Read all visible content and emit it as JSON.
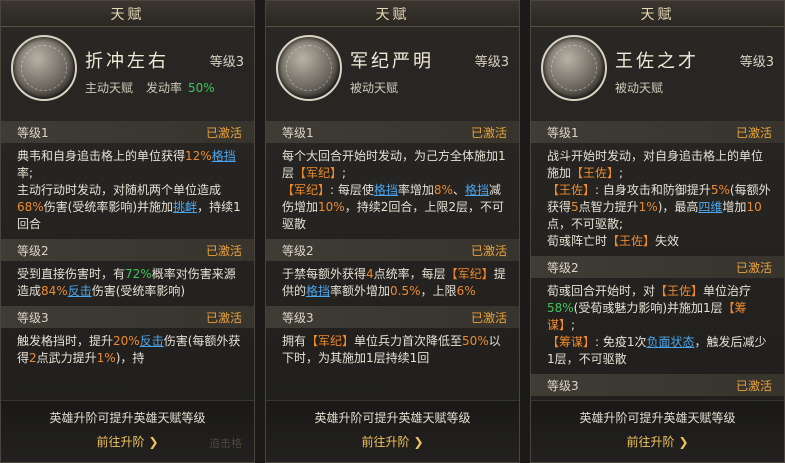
{
  "panels": [
    {
      "title": "天赋",
      "name": "折冲左右",
      "level": "等级3",
      "type": "主动天赋",
      "trigger_label": "发动率",
      "trigger_rate": "50%",
      "icon": "talent-icon-zhechong",
      "rows": [
        {
          "label": "等级1",
          "status": "已激活",
          "segments": [
            {
              "t": "典韦和自身追击格上的单位获得"
            },
            {
              "t": "12%",
              "c": "o"
            },
            {
              "t": "格挡",
              "c": "b"
            },
            {
              "t": "率;\n主动行动时发动，对随机两个单位造成"
            },
            {
              "t": "68%",
              "c": "o"
            },
            {
              "t": "伤害(受统率影响)并施加"
            },
            {
              "t": "挑衅",
              "c": "b"
            },
            {
              "t": "，持续1回合"
            }
          ]
        },
        {
          "label": "等级2",
          "status": "已激活",
          "segments": [
            {
              "t": "受到直接伤害时，有"
            },
            {
              "t": "72%",
              "c": "g"
            },
            {
              "t": "概率对伤害来源造成"
            },
            {
              "t": "84%",
              "c": "o"
            },
            {
              "t": "反击",
              "c": "b"
            },
            {
              "t": "伤害(受统率影响)"
            }
          ]
        },
        {
          "label": "等级3",
          "status": "已激活",
          "segments": [
            {
              "t": "触发格挡时，提升"
            },
            {
              "t": "20%",
              "c": "o"
            },
            {
              "t": "反击",
              "c": "b"
            },
            {
              "t": "伤害(每额外获得"
            },
            {
              "t": "2",
              "c": "o"
            },
            {
              "t": "点武力提升"
            },
            {
              "t": "1%",
              "c": "o"
            },
            {
              "t": ")，持"
            }
          ]
        }
      ],
      "footer_tip": "英雄升阶可提升英雄天赋等级",
      "footer_button": "前往升阶",
      "ghost_text": "追击格"
    },
    {
      "title": "天赋",
      "name": "军纪严明",
      "level": "等级3",
      "type": "被动天赋",
      "icon": "talent-icon-junji",
      "rows": [
        {
          "label": "等级1",
          "status": "已激活",
          "segments": [
            {
              "t": "每个大回合开始时发动，为己方全体施加1层"
            },
            {
              "t": "【军纪】",
              "c": "o"
            },
            {
              "t": ";\n"
            },
            {
              "t": "【军纪】",
              "c": "o"
            },
            {
              "t": ": 每层使"
            },
            {
              "t": "格挡",
              "c": "b"
            },
            {
              "t": "率增加"
            },
            {
              "t": "8%",
              "c": "o"
            },
            {
              "t": "、"
            },
            {
              "t": "格挡",
              "c": "b"
            },
            {
              "t": "减伤增加"
            },
            {
              "t": "10%",
              "c": "o"
            },
            {
              "t": "，持续2回合，上限2层，不可驱散"
            }
          ]
        },
        {
          "label": "等级2",
          "status": "已激活",
          "segments": [
            {
              "t": "于禁每额外获得"
            },
            {
              "t": "4",
              "c": "o"
            },
            {
              "t": "点统率，每层"
            },
            {
              "t": "【军纪】",
              "c": "o"
            },
            {
              "t": "提供的"
            },
            {
              "t": "格挡",
              "c": "b"
            },
            {
              "t": "率额外增加"
            },
            {
              "t": "0.5%",
              "c": "o"
            },
            {
              "t": "，上限"
            },
            {
              "t": "6%",
              "c": "o"
            }
          ]
        },
        {
          "label": "等级3",
          "status": "已激活",
          "segments": [
            {
              "t": "拥有"
            },
            {
              "t": "【军纪】",
              "c": "o"
            },
            {
              "t": "单位兵力首次降低至"
            },
            {
              "t": "50%",
              "c": "o"
            },
            {
              "t": "以下时，为其施加1层持续1回"
            }
          ]
        }
      ],
      "footer_tip": "英雄升阶可提升英雄天赋等级",
      "footer_button": "前往升阶",
      "ghost_text": ""
    },
    {
      "title": "天赋",
      "name": "王佐之才",
      "level": "等级3",
      "type": "被动天赋",
      "icon": "talent-icon-wangzuo",
      "rows": [
        {
          "label": "等级1",
          "status": "已激活",
          "segments": [
            {
              "t": "战斗开始时发动，对自身追击格上的单位施加"
            },
            {
              "t": "【王佐】",
              "c": "o"
            },
            {
              "t": ";\n"
            },
            {
              "t": "【王佐】",
              "c": "o"
            },
            {
              "t": ": 自身攻击和防御提升"
            },
            {
              "t": "5%",
              "c": "o"
            },
            {
              "t": "(每额外获得"
            },
            {
              "t": "5",
              "c": "o"
            },
            {
              "t": "点智力提升"
            },
            {
              "t": "1%",
              "c": "o"
            },
            {
              "t": ")，最高"
            },
            {
              "t": "四维",
              "c": "b"
            },
            {
              "t": "增加"
            },
            {
              "t": "10",
              "c": "o"
            },
            {
              "t": "点，不可驱散;\n荀彧阵亡时"
            },
            {
              "t": "【王佐】",
              "c": "o"
            },
            {
              "t": "失效"
            }
          ]
        },
        {
          "label": "等级2",
          "status": "已激活",
          "segments": [
            {
              "t": "荀彧回合开始时，对"
            },
            {
              "t": "【王佐】",
              "c": "o"
            },
            {
              "t": "单位治疗"
            },
            {
              "t": "58%",
              "c": "g"
            },
            {
              "t": "(受荀彧魅力影响)并施加1层"
            },
            {
              "t": "【筹谋】",
              "c": "o"
            },
            {
              "t": ";\n"
            },
            {
              "t": "【筹谋】",
              "c": "o"
            },
            {
              "t": ": 免疫1次"
            },
            {
              "t": "负面状态",
              "c": "b"
            },
            {
              "t": "，触发后减少1层，不可驱散"
            }
          ]
        },
        {
          "label": "等级3",
          "status": "已激活",
          "segments": []
        }
      ],
      "footer_tip": "英雄升阶可提升英雄天赋等级",
      "footer_button": "前往升阶",
      "ghost_text": ""
    }
  ]
}
